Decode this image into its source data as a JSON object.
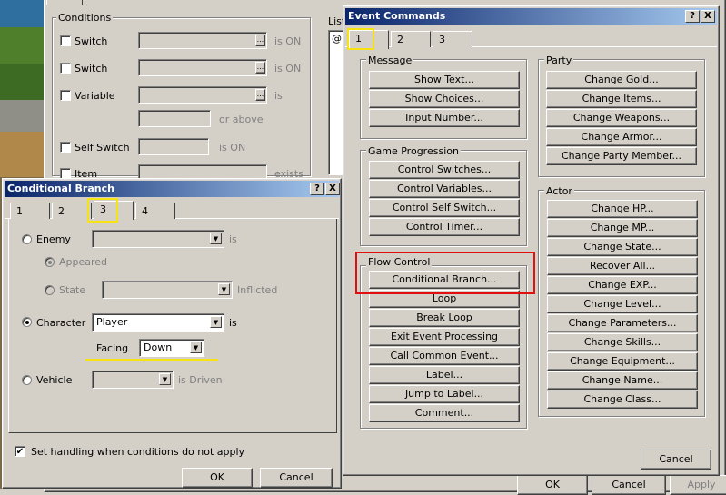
{
  "colors": {
    "highlight_yellow": "#f5e313",
    "highlight_red": "#e01010",
    "title_blue": "#0a246a"
  },
  "bg_dialog": {
    "conditions_label": "Conditions",
    "list_label": "List",
    "list_value": "@:",
    "rows": [
      {
        "label": "Switch",
        "suffix": "is ON"
      },
      {
        "label": "Switch",
        "suffix": "is ON"
      },
      {
        "label": "Variable",
        "suffix": "is"
      },
      {
        "label": "",
        "suffix": "or above"
      },
      {
        "label": "Self Switch",
        "suffix": "is ON"
      },
      {
        "label": "Item",
        "suffix": "exists"
      }
    ],
    "ok": "OK",
    "cancel": "Cancel",
    "apply": "Apply",
    "ellipsis": "..."
  },
  "event_commands": {
    "title": "Event Commands",
    "help": "?",
    "close": "X",
    "tabs": [
      "1",
      "2",
      "3"
    ],
    "groups": {
      "message": {
        "label": "Message",
        "items": [
          "Show Text...",
          "Show Choices...",
          "Input Number..."
        ]
      },
      "party": {
        "label": "Party",
        "items": [
          "Change Gold...",
          "Change Items...",
          "Change Weapons...",
          "Change Armor...",
          "Change Party Member..."
        ]
      },
      "game_progression": {
        "label": "Game Progression",
        "items": [
          "Control Switches...",
          "Control Variables...",
          "Control Self Switch...",
          "Control Timer..."
        ]
      },
      "flow_control": {
        "label": "Flow Control",
        "items": [
          "Conditional Branch...",
          "Loop",
          "Break Loop",
          "Exit Event Processing",
          "Call Common Event...",
          "Label...",
          "Jump to Label...",
          "Comment..."
        ]
      },
      "actor": {
        "label": "Actor",
        "items": [
          "Change HP...",
          "Change MP...",
          "Change State...",
          "Recover All...",
          "Change EXP...",
          "Change Level...",
          "Change Parameters...",
          "Change Skills...",
          "Change Equipment...",
          "Change Name...",
          "Change Class..."
        ]
      }
    },
    "cancel": "Cancel"
  },
  "cond_branch": {
    "title": "Conditional Branch",
    "help": "?",
    "close": "X",
    "tabs": [
      "1",
      "2",
      "3",
      "4"
    ],
    "enemy": {
      "label": "Enemy",
      "suffix": "is",
      "appeared": "Appeared",
      "state": "State",
      "inflicted": "Inflicted"
    },
    "character": {
      "label": "Character",
      "value": "Player",
      "suffix": "is",
      "facing_label": "Facing",
      "facing_value": "Down"
    },
    "vehicle": {
      "label": "Vehicle",
      "suffix": "is Driven"
    },
    "handling": "Set handling when conditions do not apply",
    "ok": "OK",
    "cancel": "Cancel"
  }
}
